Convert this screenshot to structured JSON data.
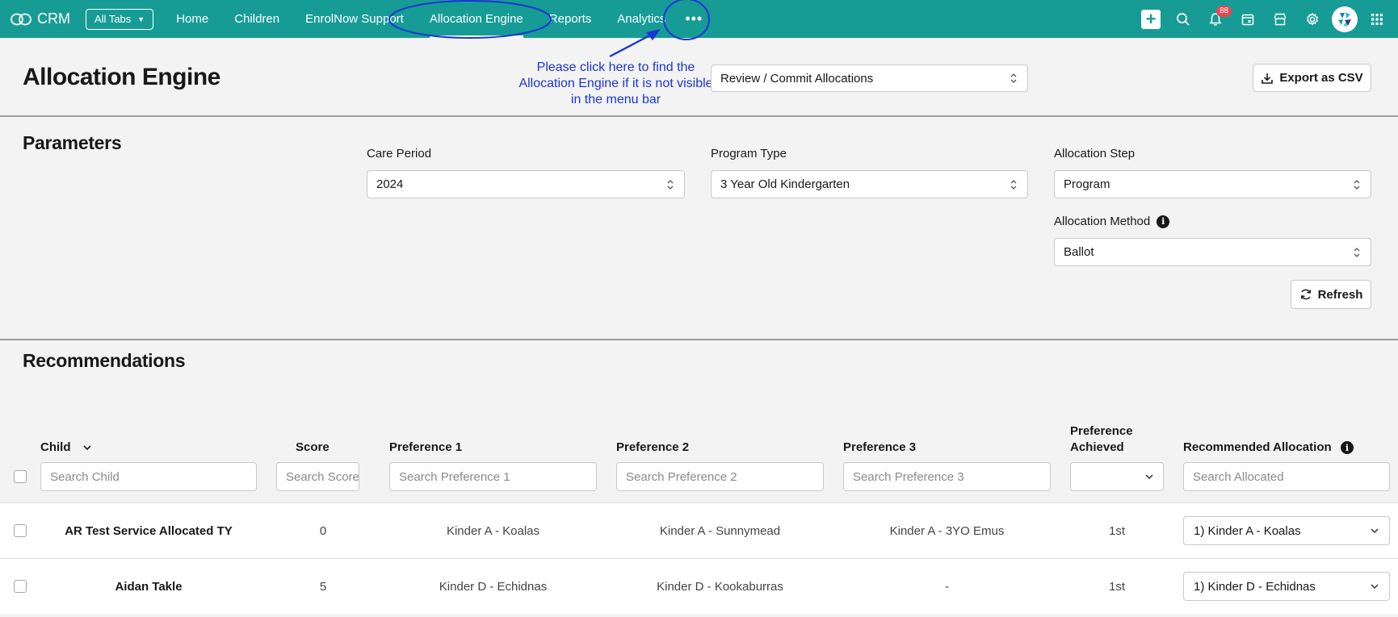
{
  "nav": {
    "brand": "CRM",
    "all_tabs": "All Tabs",
    "links": [
      "Home",
      "Children",
      "EnrolNow Support",
      "Allocation Engine",
      "Reports",
      "Analytics"
    ],
    "active": "Allocation Engine",
    "more": "•••",
    "notification_count": "88",
    "icons": [
      "plus-icon",
      "search-icon",
      "bell-icon",
      "calendar-icon",
      "store-icon",
      "gear-icon",
      "avatar",
      "app-launcher-icon"
    ]
  },
  "header": {
    "title": "Allocation Engine",
    "hint": "Please click here to find the Allocation Engine if it is not visible in the menu bar",
    "mode_select": "Review / Commit Allocations",
    "export_label": "Export as CSV"
  },
  "parameters": {
    "title": "Parameters",
    "care_period": {
      "label": "Care Period",
      "value": "2024"
    },
    "program_type": {
      "label": "Program Type",
      "value": "3 Year Old Kindergarten"
    },
    "allocation_step": {
      "label": "Allocation Step",
      "value": "Program"
    },
    "allocation_method": {
      "label": "Allocation Method",
      "value": "Ballot"
    },
    "refresh_label": "Refresh"
  },
  "recommendations": {
    "title": "Recommendations",
    "columns": {
      "child": "Child",
      "score": "Score",
      "pref1": "Preference 1",
      "pref2": "Preference 2",
      "pref3": "Preference 3",
      "pref_achieved_1": "Preference",
      "pref_achieved_2": "Achieved",
      "recommended": "Recommended Allocation"
    },
    "placeholders": {
      "child": "Search Child",
      "score": "Search Score",
      "pref1": "Search Preference 1",
      "pref2": "Search Preference 2",
      "pref3": "Search Preference 3",
      "recommended": "Search Allocated"
    },
    "rows": [
      {
        "child": "AR Test Service Allocated TY",
        "score": "0",
        "pref1": "Kinder A - Koalas",
        "pref2": "Kinder A - Sunnymead",
        "pref3": "Kinder A - 3YO Emus",
        "achieved": "1st",
        "allocation": "1) Kinder A - Koalas"
      },
      {
        "child": "Aidan Takle",
        "score": "5",
        "pref1": "Kinder D - Echidnas",
        "pref2": "Kinder D - Kookaburras",
        "pref3": "-",
        "achieved": "1st",
        "allocation": "1) Kinder D - Echidnas"
      }
    ]
  },
  "colors": {
    "nav_bg": "#179c95",
    "annotation": "#1a35d6",
    "badge": "#e5484d"
  }
}
